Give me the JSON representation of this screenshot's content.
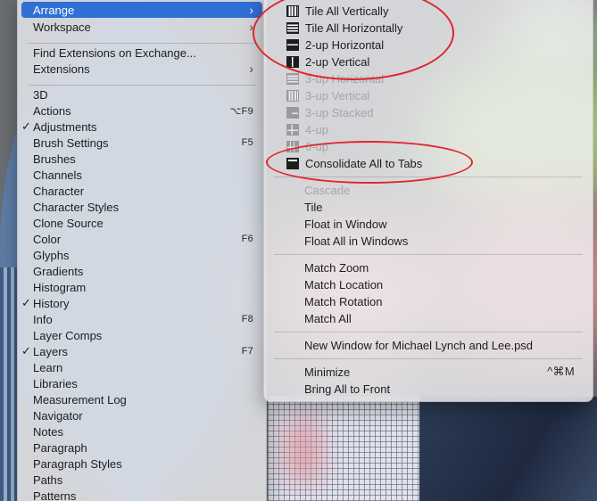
{
  "left_menu": {
    "items": [
      {
        "label": "Arrange",
        "arrow": "›",
        "highlighted": true
      },
      {
        "label": "Workspace",
        "arrow": "›"
      },
      {
        "separator": true
      },
      {
        "label": "Find Extensions on Exchange..."
      },
      {
        "label": "Extensions",
        "arrow": "›"
      },
      {
        "separator": true
      },
      {
        "label": "3D"
      },
      {
        "label": "Actions",
        "shortcut": "⌥F9"
      },
      {
        "label": "Adjustments",
        "checked": true
      },
      {
        "label": "Brush Settings",
        "shortcut": "F5"
      },
      {
        "label": "Brushes"
      },
      {
        "label": "Channels"
      },
      {
        "label": "Character"
      },
      {
        "label": "Character Styles"
      },
      {
        "label": "Clone Source"
      },
      {
        "label": "Color",
        "shortcut": "F6"
      },
      {
        "label": "Glyphs"
      },
      {
        "label": "Gradients"
      },
      {
        "label": "Histogram"
      },
      {
        "label": "History",
        "checked": true
      },
      {
        "label": "Info",
        "shortcut": "F8"
      },
      {
        "label": "Layer Comps"
      },
      {
        "label": "Layers",
        "checked": true,
        "shortcut": "F7"
      },
      {
        "label": "Learn"
      },
      {
        "label": "Libraries"
      },
      {
        "label": "Measurement Log"
      },
      {
        "label": "Navigator"
      },
      {
        "label": "Notes"
      },
      {
        "label": "Paragraph"
      },
      {
        "label": "Paragraph Styles"
      },
      {
        "label": "Paths"
      },
      {
        "label": "Patterns"
      }
    ]
  },
  "arrange_submenu": {
    "items": [
      {
        "label": "Tile All Vertically",
        "icon": "tile-vertical-icon"
      },
      {
        "label": "Tile All Horizontally",
        "icon": "tile-horizontal-icon"
      },
      {
        "label": "2-up Horizontal",
        "icon": "two-up-horizontal-icon"
      },
      {
        "label": "2-up Vertical",
        "icon": "two-up-vertical-icon"
      },
      {
        "label": "3-up Horizontal",
        "icon": "three-up-horizontal-icon",
        "disabled": true
      },
      {
        "label": "3-up Vertical",
        "icon": "three-up-vertical-icon",
        "disabled": true
      },
      {
        "label": "3-up Stacked",
        "icon": "three-up-stacked-icon",
        "disabled": true
      },
      {
        "label": "4-up",
        "icon": "four-up-icon",
        "disabled": true
      },
      {
        "label": "6-up",
        "icon": "six-up-icon",
        "disabled": true
      },
      {
        "label": "Consolidate All to Tabs",
        "icon": "consolidate-tabs-icon"
      },
      {
        "separator": true
      },
      {
        "label": "Cascade",
        "disabled": true
      },
      {
        "label": "Tile"
      },
      {
        "label": "Float in Window"
      },
      {
        "label": "Float All in Windows"
      },
      {
        "separator": true
      },
      {
        "label": "Match Zoom"
      },
      {
        "label": "Match Location"
      },
      {
        "label": "Match Rotation"
      },
      {
        "label": "Match All"
      },
      {
        "separator": true
      },
      {
        "label": "New Window for Michael Lynch and Lee.psd"
      },
      {
        "separator": true
      },
      {
        "label": "Minimize",
        "shortcut": "^⌘M"
      },
      {
        "label": "Bring All to Front"
      }
    ]
  },
  "colors": {
    "highlight": "#2f6fd6",
    "annotation": "#e0262b",
    "disabled_text": "#a5a5a7"
  }
}
